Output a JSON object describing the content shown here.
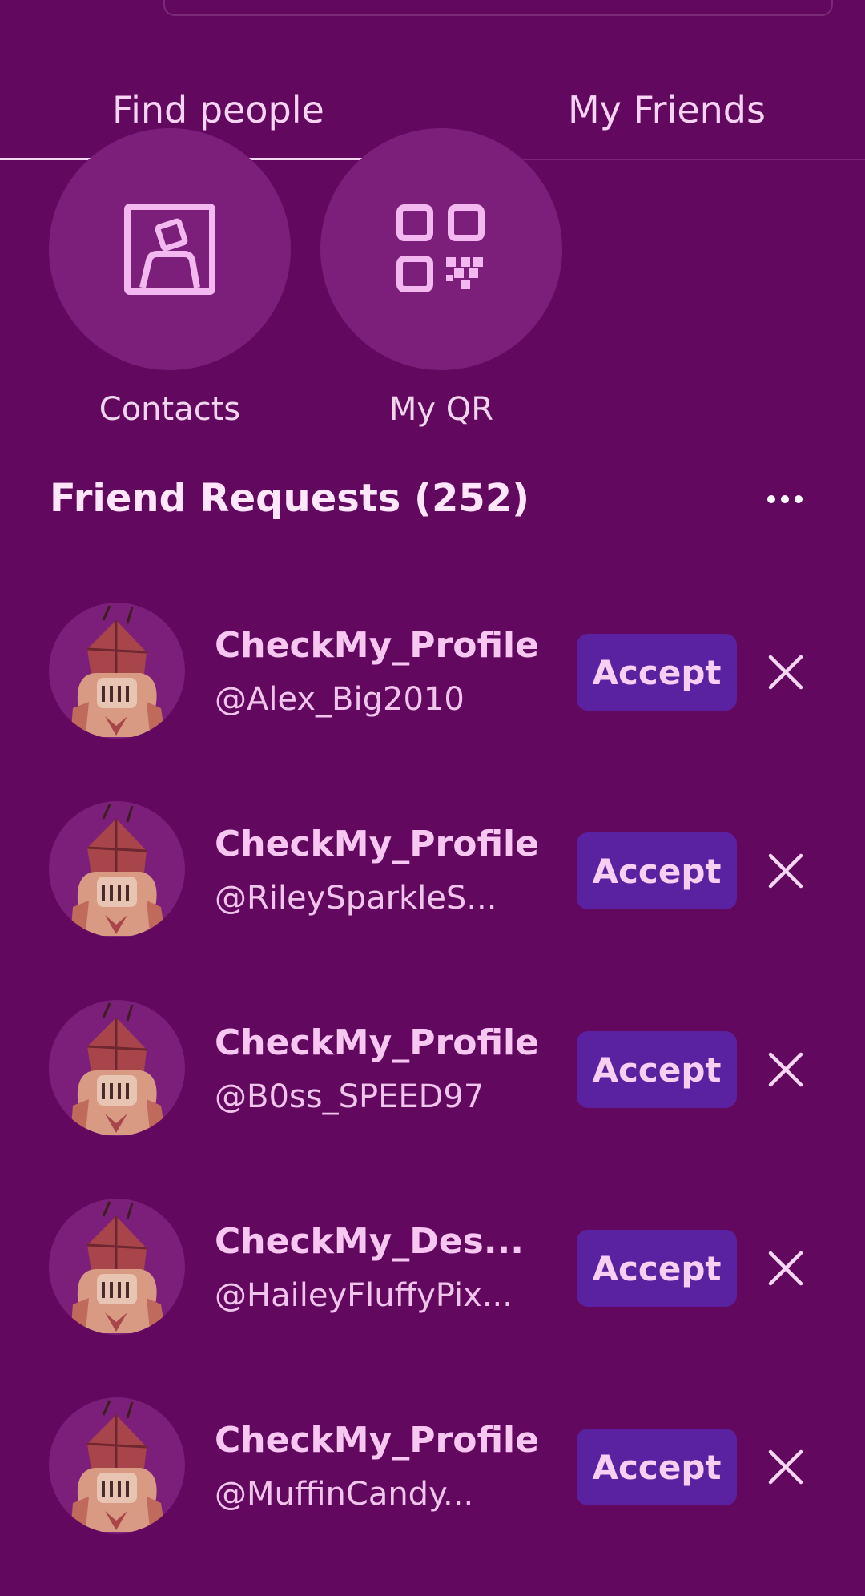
{
  "tabs": {
    "find_people": "Find people",
    "my_friends": "My Friends"
  },
  "shortcuts": {
    "contacts": "Contacts",
    "my_qr": "My QR"
  },
  "friend_requests": {
    "title": "Friend Requests (252)",
    "more_icon": "ellipsis-icon",
    "accept_label": "Accept",
    "decline_icon": "close-icon",
    "items": [
      {
        "name": "CheckMy_Profile",
        "handle": "@Alex_Big2010"
      },
      {
        "name": "CheckMy_Profile",
        "handle": "@RileySparkleS..."
      },
      {
        "name": "CheckMy_Profile",
        "handle": "@B0ss_SPEED97"
      },
      {
        "name": "CheckMy_Des...",
        "handle": "@HaileyFluffyPix..."
      },
      {
        "name": "CheckMy_Profile",
        "handle": "@MuffinCandy..."
      }
    ]
  },
  "colors": {
    "background": "#62085f",
    "circle": "#7b1f7a",
    "accept_button": "#5a22a0",
    "text": "#f7c7f1"
  }
}
